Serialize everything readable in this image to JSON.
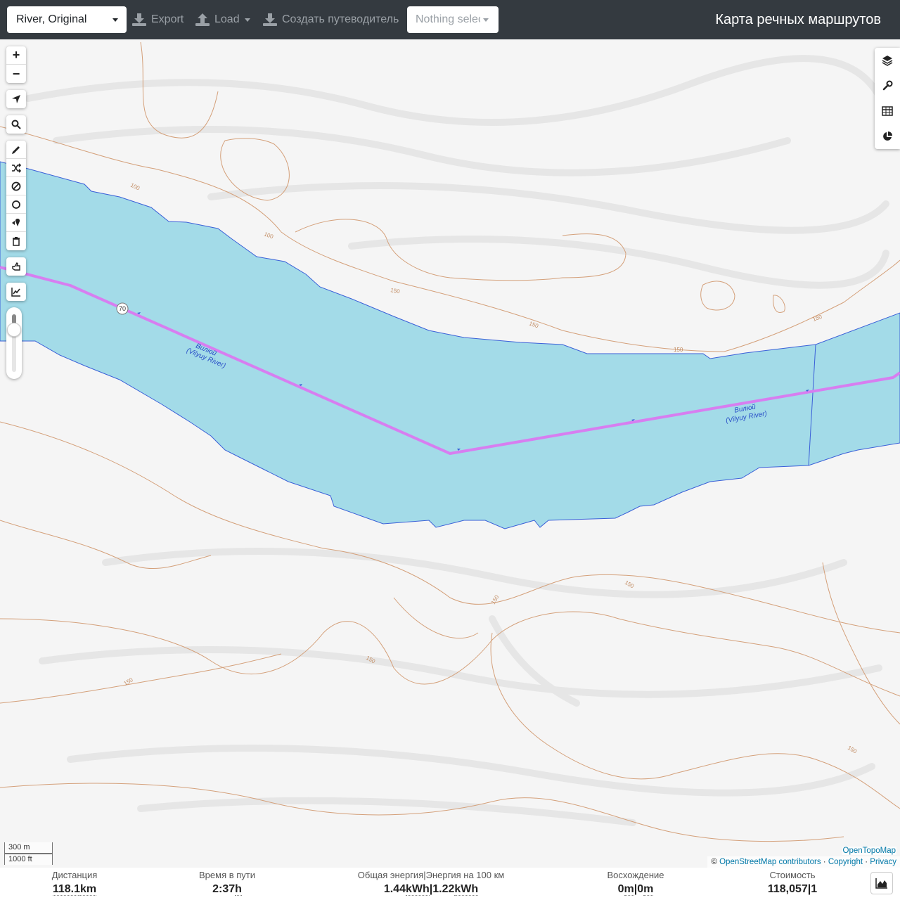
{
  "navbar": {
    "profile": "River, Original",
    "export_label": "Export",
    "load_label": "Load",
    "guide_label": "Создать путеводитель",
    "selection_placeholder": "Nothing selected",
    "brand": "Карта речных маршрутов"
  },
  "map": {
    "river_label_ru": "Вилюй",
    "river_label_en": "(Vilyuy River)",
    "route_shield": "70",
    "contour_labels": [
      "100",
      "100",
      "150",
      "150",
      "150",
      "150",
      "150",
      "150",
      "150",
      "150",
      "150"
    ],
    "scale_metric": "300 m",
    "scale_imperial": "1000 ft",
    "layer_name": "OpenTopoMap",
    "attribution": {
      "prefix": "©",
      "osm": "OpenStreetMap contributors",
      "copyright": "Copyright",
      "privacy": "Privacy",
      "separator": "·"
    }
  },
  "colors": {
    "navbar": "#343a40",
    "water": "#a3dbe8",
    "route": "#d77ef0",
    "contour": "#d4a07a"
  },
  "left_controls": {
    "zoom_in": "+",
    "zoom_out": "−"
  },
  "stats": {
    "distance": {
      "label": "Дистанция",
      "value": "118.1",
      "unit": "km"
    },
    "time": {
      "label": "Время в пути",
      "value": "2:37",
      "unit": "h"
    },
    "energy": {
      "label": "Общая энергия",
      "label2": "Энергия на 100 км",
      "value": "1.44",
      "unit": "kWh",
      "value2": "1.22",
      "unit2": "kWh"
    },
    "ascent": {
      "label": "Восхождение",
      "value": "0",
      "unit": "m",
      "value2": "0",
      "unit2": "m"
    },
    "cost": {
      "label": "Стоимость",
      "value": "118,057",
      "value2": "1"
    },
    "pipe": "|"
  }
}
